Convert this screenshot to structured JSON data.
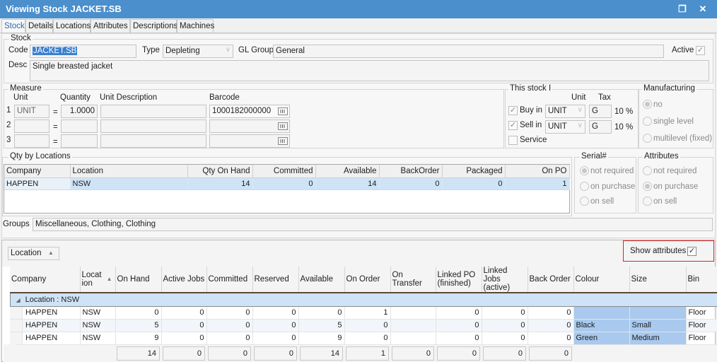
{
  "window": {
    "title": "Viewing Stock JACKET.SB",
    "restore_icon": "restore-window-icon",
    "close_icon": "close-icon"
  },
  "tabs": [
    {
      "label": "Stock",
      "active": true
    },
    {
      "label": "Details"
    },
    {
      "label": "Locations"
    },
    {
      "label": "Attributes"
    },
    {
      "label": "Descriptions"
    },
    {
      "label": "Machines"
    }
  ],
  "stock": {
    "group_label": "Stock",
    "code_label": "Code",
    "code_value": "JACKET.SB",
    "type_label": "Type",
    "type_value": "Depleting",
    "gl_group_label": "GL Group",
    "gl_group_value": "General",
    "active_label": "Active",
    "active_checked": true,
    "desc_label": "Desc",
    "desc_value": "Single breasted jacket"
  },
  "measure": {
    "group_label": "Measure",
    "headers": {
      "unit": "Unit",
      "quantity": "Quantity",
      "unit_description": "Unit Description",
      "barcode": "Barcode"
    },
    "equals": "=",
    "rows": [
      {
        "num": "1",
        "unit": "UNIT",
        "quantity": "1.0000",
        "unit_description": "",
        "barcode": "1000182000000"
      },
      {
        "num": "2",
        "unit": "",
        "quantity": "",
        "unit_description": "",
        "barcode": ""
      },
      {
        "num": "3",
        "unit": "",
        "quantity": "",
        "unit_description": "",
        "barcode": ""
      }
    ]
  },
  "this_stock": {
    "group_label": "This stock I",
    "unit_header": "Unit",
    "tax_header": "Tax",
    "buy_in": {
      "label": "Buy in",
      "checked": true,
      "unit": "UNIT",
      "tax": "G",
      "rate": "10 %"
    },
    "sell_in": {
      "label": "Sell in",
      "checked": true,
      "unit": "UNIT",
      "tax": "G",
      "rate": "10 %"
    },
    "service": {
      "label": "Service",
      "checked": false
    }
  },
  "manufacturing": {
    "group_label": "Manufacturing",
    "options": [
      "no",
      "single level",
      "multilevel (fixed)"
    ],
    "selected": "no"
  },
  "qty_by_locations": {
    "group_label": "Qty by Locations",
    "columns": [
      "Company",
      "Location",
      "Qty On Hand",
      "Committed",
      "Available",
      "BackOrder",
      "Packaged",
      "On PO"
    ],
    "rows": [
      [
        "HAPPEN",
        "NSW",
        "14",
        "0",
        "14",
        "0",
        "0",
        "1"
      ]
    ]
  },
  "serial": {
    "group_label": "Serial#",
    "options": [
      "not required",
      "on purchase",
      "on sell"
    ],
    "selected": "not required"
  },
  "attributes": {
    "group_label": "Attributes",
    "options": [
      "not required",
      "on purchase",
      "on sell"
    ],
    "selected": "on purchase"
  },
  "groups": {
    "label": "Groups",
    "value": "Miscellaneous, Clothing, Clothing"
  },
  "location_grid": {
    "group_chip": "Location",
    "show_attributes_label": "Show attributes",
    "show_attributes_checked": true,
    "columns": [
      "Company",
      "Locat ion",
      "On Hand",
      "Active Jobs",
      "Committed",
      "Reserved",
      "Available",
      "On Order",
      "On Transfer",
      "Linked PO (finished)",
      "Linked Jobs (active)",
      "Back Order",
      "Colour",
      "Size",
      "Bin"
    ],
    "group_row": "Location : NSW",
    "rows": [
      [
        "HAPPEN",
        "NSW",
        "0",
        "0",
        "0",
        "0",
        "0",
        "1",
        "",
        "0",
        "0",
        "0",
        "",
        "",
        "Floor"
      ],
      [
        "HAPPEN",
        "NSW",
        "5",
        "0",
        "0",
        "0",
        "5",
        "0",
        "",
        "0",
        "0",
        "0",
        "Black",
        "Small",
        "Floor"
      ],
      [
        "HAPPEN",
        "NSW",
        "9",
        "0",
        "0",
        "0",
        "9",
        "0",
        "",
        "0",
        "0",
        "0",
        "Green",
        "Medium",
        "Floor"
      ]
    ],
    "totals": [
      "14",
      "0",
      "0",
      "0",
      "14",
      "1",
      "0",
      "0",
      "0",
      "0"
    ]
  }
}
